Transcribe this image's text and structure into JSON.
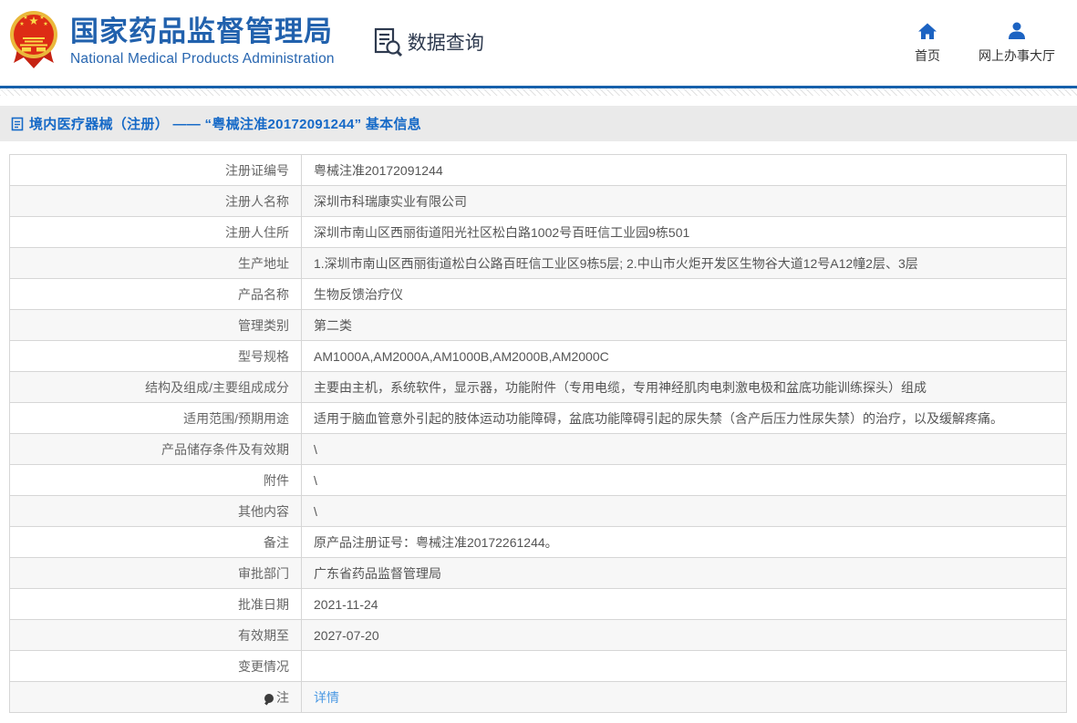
{
  "colors": {
    "brand_blue": "#2161ad",
    "accent_line_blue": "#1660ab",
    "breadcrumb_blue": "#1569c7",
    "link_blue": "#4b99e3",
    "nav_icon_blue": "#1c63c2"
  },
  "header": {
    "agency_name_cn": "国家药品监督管理局",
    "agency_name_en": "National Medical Products Administration",
    "section_label": "数据查询",
    "nav": [
      {
        "label": "首页",
        "icon": "home-icon"
      },
      {
        "label": "网上办事大厅",
        "icon": "user-icon"
      }
    ]
  },
  "breadcrumb": {
    "text": "境内医疗器械（注册） —— “粤械注准20172091244” 基本信息"
  },
  "table": {
    "rows": [
      {
        "label": "注册证编号",
        "value": "粤械注准20172091244"
      },
      {
        "label": "注册人名称",
        "value": "深圳市科瑞康实业有限公司"
      },
      {
        "label": "注册人住所",
        "value": "深圳市南山区西丽街道阳光社区松白路1002号百旺信工业园9栋501"
      },
      {
        "label": "生产地址",
        "value": "1.深圳市南山区西丽街道松白公路百旺信工业区9栋5层; 2.中山市火炬开发区生物谷大道12号A12幢2层、3层"
      },
      {
        "label": "产品名称",
        "value": "生物反馈治疗仪"
      },
      {
        "label": "管理类别",
        "value": "第二类"
      },
      {
        "label": "型号规格",
        "value": "AM1000A,AM2000A,AM1000B,AM2000B,AM2000C"
      },
      {
        "label": "结构及组成/主要组成成分",
        "value": "主要由主机，系统软件，显示器，功能附件（专用电缆，专用神经肌肉电刺激电极和盆底功能训练探头）组成"
      },
      {
        "label": "适用范围/预期用途",
        "value": "适用于脑血管意外引起的肢体运动功能障碍，盆底功能障碍引起的尿失禁（含产后压力性尿失禁）的治疗，以及缓解疼痛。"
      },
      {
        "label": "产品储存条件及有效期",
        "value": "\\"
      },
      {
        "label": "附件",
        "value": "\\"
      },
      {
        "label": "其他内容",
        "value": "\\"
      },
      {
        "label": "备注",
        "value": "原产品注册证号：粤械注准20172261244。"
      },
      {
        "label": "审批部门",
        "value": "广东省药品监督管理局"
      },
      {
        "label": "批准日期",
        "value": "2021-11-24"
      },
      {
        "label": "有效期至",
        "value": "2027-07-20"
      },
      {
        "label": "变更情况",
        "value": ""
      },
      {
        "label": "注",
        "label_icon": "bulb",
        "value": "详情",
        "link": true
      }
    ]
  }
}
